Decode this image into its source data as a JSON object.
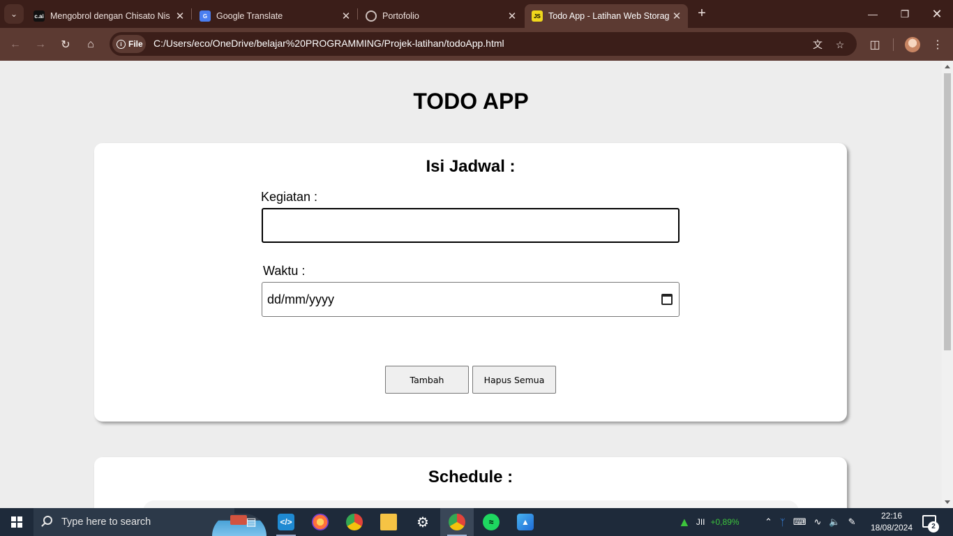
{
  "browser": {
    "tabs": [
      {
        "title": "Mengobrol dengan Chisato Nis",
        "icon": "c.ai"
      },
      {
        "title": "Google Translate",
        "icon": "google-translate"
      },
      {
        "title": "Portofolio",
        "icon": "globe"
      },
      {
        "title": "Todo App - Latihan Web Storag",
        "icon": "JS",
        "active": true
      }
    ],
    "site_chip": "File",
    "url": "C:/Users/eco/OneDrive/belajar%20PROGRAMMING/Projek-latihan/todoApp.html"
  },
  "page": {
    "title": "TODO APP",
    "form": {
      "heading": "Isi Jadwal :",
      "kegiatan_label": "Kegiatan :",
      "kegiatan_value": "",
      "waktu_label": "Waktu :",
      "waktu_placeholder": "dd/mm/yyyy",
      "add_button": "Tambah",
      "clear_button": "Hapus Semua"
    },
    "schedule": {
      "heading": "Schedule :"
    }
  },
  "taskbar": {
    "search_placeholder": "Type here to search",
    "stock_label": "JII",
    "stock_change": "+0,89%",
    "time": "22:16",
    "date": "18/08/2024",
    "notification_count": "2"
  },
  "colors": {
    "titlebar": "#3b1e19",
    "toolbar": "#5c3a32",
    "page_bg": "#ededed",
    "stock_green": "#3cc43c"
  }
}
